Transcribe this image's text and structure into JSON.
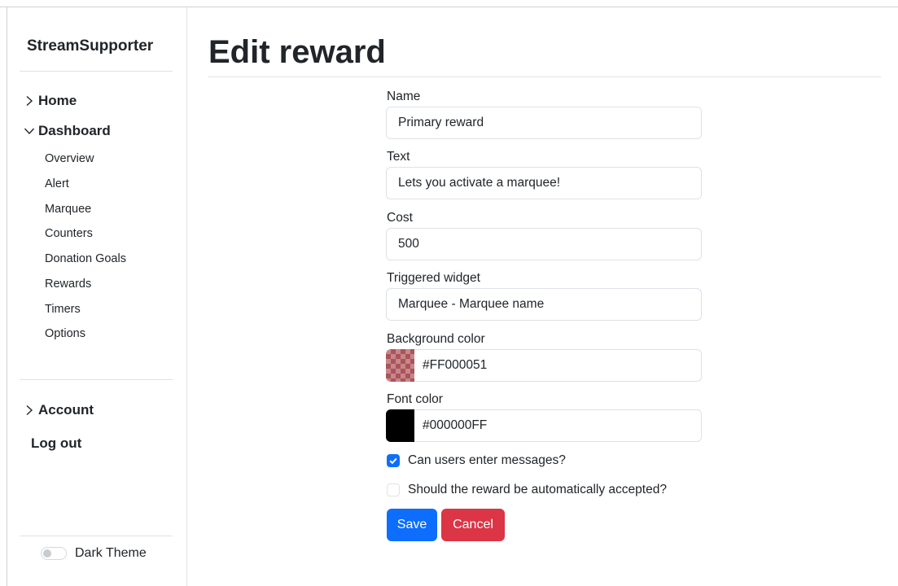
{
  "sidebar": {
    "brand": "StreamSupporter",
    "home": "Home",
    "dashboard": "Dashboard",
    "dashboard_items": [
      "Overview",
      "Alert",
      "Marquee",
      "Counters",
      "Donation Goals",
      "Rewards",
      "Timers",
      "Options"
    ],
    "account": "Account",
    "logout": "Log out",
    "dark_theme": "Dark Theme",
    "dark_theme_enabled": false
  },
  "page": {
    "title": "Edit reward"
  },
  "form": {
    "name_label": "Name",
    "name_value": "Primary reward",
    "text_label": "Text",
    "text_value": "Lets you activate a marquee!",
    "cost_label": "Cost",
    "cost_value": "500",
    "widget_label": "Triggered widget",
    "widget_value": "Marquee - Marquee name",
    "bg_color_label": "Background color",
    "bg_color_value": "#FF000051",
    "font_color_label": "Font color",
    "font_color_value": "#000000FF",
    "messages_label": "Can users enter messages?",
    "messages_checked": true,
    "auto_accept_label": "Should the reward be automatically accepted?",
    "auto_accept_checked": false,
    "save_label": "Save",
    "cancel_label": "Cancel"
  },
  "colors": {
    "primary": "#0d6efd",
    "danger": "#dc3545"
  }
}
